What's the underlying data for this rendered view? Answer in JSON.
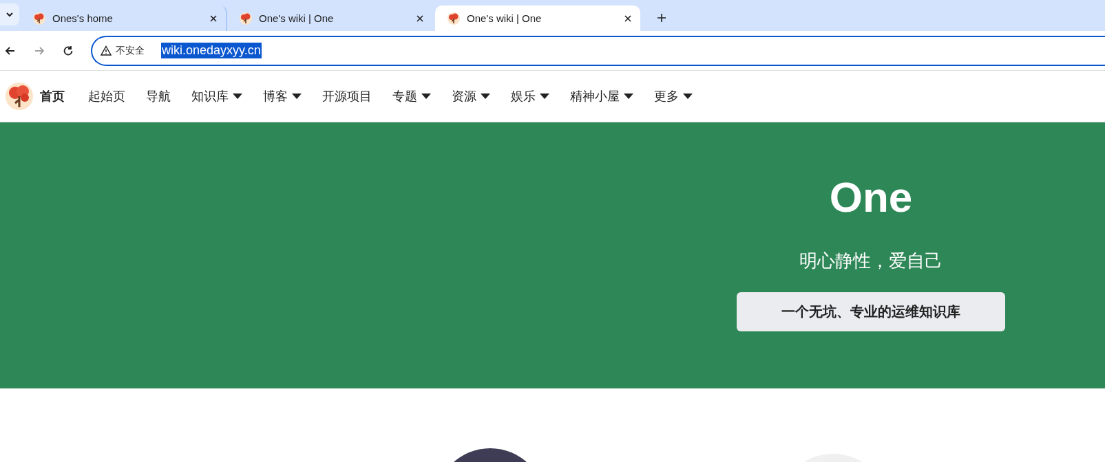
{
  "tabs": [
    {
      "title": "Ones's home",
      "selected": false
    },
    {
      "title": "One's wiki | One",
      "selected": false
    },
    {
      "title": "One's wiki | One",
      "selected": true
    }
  ],
  "toolbar": {
    "forward_disabled": true
  },
  "address": {
    "security": "不安全",
    "url": "wiki.onedayxyy.cn",
    "url_highlighted": true
  },
  "nav": {
    "home": "首页",
    "items": [
      {
        "label": "起始页",
        "has_menu": false
      },
      {
        "label": "导航",
        "has_menu": false
      },
      {
        "label": "知识库",
        "has_menu": true
      },
      {
        "label": "博客",
        "has_menu": true
      },
      {
        "label": "开源项目",
        "has_menu": false
      },
      {
        "label": "专题",
        "has_menu": true
      },
      {
        "label": "资源",
        "has_menu": true
      },
      {
        "label": "娱乐",
        "has_menu": true
      },
      {
        "label": "精神小屋",
        "has_menu": true
      },
      {
        "label": "更多",
        "has_menu": true
      }
    ]
  },
  "hero": {
    "title": "One",
    "tagline": "明心静性，爱自己",
    "button": "一个无坑、专业的运维知识库"
  },
  "features": [
    {
      "color": "#3f3d56"
    },
    {
      "color": "#f0f0f0"
    }
  ]
}
